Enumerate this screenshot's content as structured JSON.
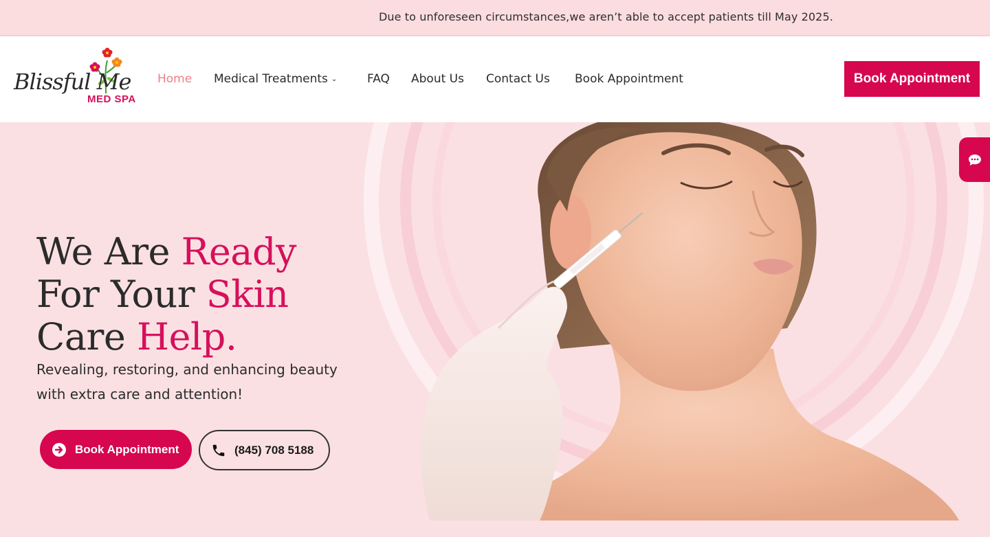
{
  "announcement": {
    "text": "Due to unforeseen circumstances,we aren’t able to accept patients till May 2025."
  },
  "brand": {
    "logo_script": "Blissful Me",
    "logo_sub": "MED SPA",
    "accent_color": "#d6064f",
    "soft_pink": "#fbe0e3"
  },
  "nav": {
    "items": [
      {
        "label": "Home",
        "active": true
      },
      {
        "label": "Medical Treatments",
        "has_dropdown": true
      },
      {
        "label": "FAQ"
      },
      {
        "label": "About Us"
      },
      {
        "label": "Contact Us"
      },
      {
        "label": "Book Appointment"
      }
    ],
    "cta_label": "Book Appointment"
  },
  "hero": {
    "line1_a": "We Are",
    "line1_b": "Ready",
    "line2_a": "For Your",
    "line2_b": "Skin",
    "line3_a": "Care",
    "line3_b": "Help.",
    "subtitle": "Revealing, restoring, and enhancing beauty with extra care and attention!",
    "book_label": "Book Appointment",
    "phone_label": "(845) 708 5188"
  },
  "icons": {
    "book_button": "arrow-circle-right-icon",
    "phone_button": "phone-icon",
    "nav_dropdown": "chevron-down-icon",
    "chat": "chat-bubble-icon"
  }
}
